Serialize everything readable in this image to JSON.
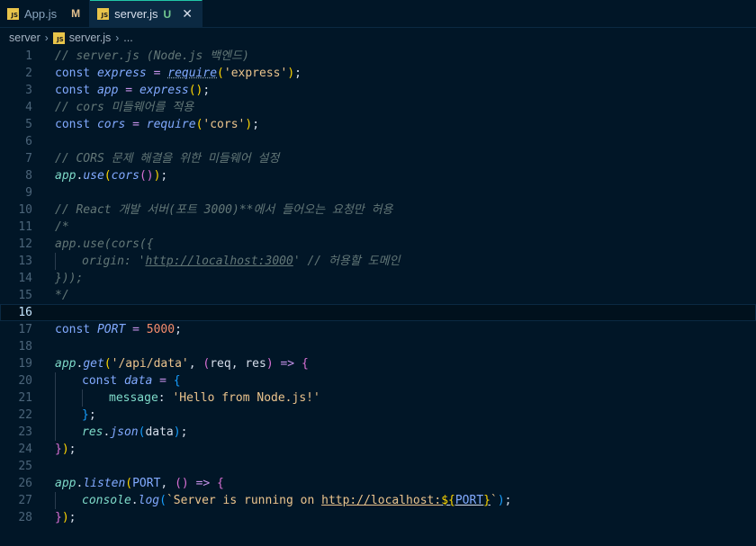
{
  "tabs": [
    {
      "icon": "JS",
      "label": "App.js",
      "status": "M"
    },
    {
      "icon": "JS",
      "label": "server.js",
      "status": "U",
      "close": "✕"
    }
  ],
  "breadcrumb": {
    "folder": "server",
    "file": "server.js",
    "more": "..."
  },
  "lines": [
    {
      "n": "1",
      "html": "<span class='cm'>// server.js (Node.js 백엔드)</span>"
    },
    {
      "n": "2",
      "html": "<span class='kw'>const</span> <span class='var'>express</span> <span class='op'>=</span> <span class='fn dotted'>require</span><span class='p1'>(</span><span class='str'>'express'</span><span class='p1'>)</span><span class='pl'>;</span>"
    },
    {
      "n": "3",
      "html": "<span class='kw'>const</span> <span class='var'>app</span> <span class='op'>=</span> <span class='fn'>express</span><span class='p1'>()</span><span class='pl'>;</span>"
    },
    {
      "n": "4",
      "html": "<span class='cm'>// cors 미들웨어를 적용</span>"
    },
    {
      "n": "5",
      "html": "<span class='kw'>const</span> <span class='var'>cors</span> <span class='op'>=</span> <span class='fn'>require</span><span class='p1'>(</span><span class='str'>'cors'</span><span class='p1'>)</span><span class='pl'>;</span>"
    },
    {
      "n": "6",
      "html": ""
    },
    {
      "n": "7",
      "html": "<span class='cm'>// CORS 문제 해결을 위한 미들웨어 설정</span>"
    },
    {
      "n": "8",
      "html": "<span class='grn' style='font-style:italic'>app</span><span class='pl'>.</span><span class='fn'>use</span><span class='p1'>(</span><span class='fn'>cors</span><span class='p2'>()</span><span class='p1'>)</span><span class='pl'>;</span>"
    },
    {
      "n": "9",
      "html": ""
    },
    {
      "n": "10",
      "html": "<span class='cm'>// React 개발 서버(포트 3000)**에서 들어오는 요청만 허용</span>"
    },
    {
      "n": "11",
      "html": "<span class='cm'>/*</span>"
    },
    {
      "n": "12",
      "html": "<span class='cm'>app.use(cors({</span>"
    },
    {
      "n": "13",
      "html": "<span class='guide'></span><span class='cm'>origin: '<span class='ul'>http://localhost:3000</span>' // 허용할 도메인</span>"
    },
    {
      "n": "14",
      "html": "<span class='cm'>}));</span>"
    },
    {
      "n": "15",
      "html": "<span class='cm'>*/</span>"
    },
    {
      "n": "16",
      "html": "",
      "current": true
    },
    {
      "n": "17",
      "html": "<span class='kw'>const</span> <span class='var'>PORT</span> <span class='op'>=</span> <span class='num'>5000</span><span class='pl'>;</span>"
    },
    {
      "n": "18",
      "html": ""
    },
    {
      "n": "19",
      "html": "<span class='grn' style='font-style:italic'>app</span><span class='pl'>.</span><span class='fn'>get</span><span class='p1'>(</span><span class='str'>'/api/data'</span><span class='pl'>, </span><span class='p2'>(</span><span class='plain'>req</span><span class='pl'>, </span><span class='plain'>res</span><span class='p2'>)</span> <span class='op'>=&gt;</span> <span class='p2'>{</span>"
    },
    {
      "n": "20",
      "html": "<span class='guide'></span><span class='kw'>const</span> <span class='var'>data</span> <span class='op'>=</span> <span class='p3'>{</span>"
    },
    {
      "n": "21",
      "html": "<span class='guide'></span><span class='guide'></span><span class='prop'>message</span><span class='pl'>: </span><span class='str'>'Hello from Node.js!'</span>"
    },
    {
      "n": "22",
      "html": "<span class='guide'></span><span class='p3'>}</span><span class='pl'>;</span>"
    },
    {
      "n": "23",
      "html": "<span class='guide'></span><span class='grn' style='font-style:italic'>res</span><span class='pl'>.</span><span class='fn'>json</span><span class='p3'>(</span><span class='plain'>data</span><span class='p3'>)</span><span class='pl'>;</span>"
    },
    {
      "n": "24",
      "html": "<span class='p2'>}</span><span class='p1'>)</span><span class='pl'>;</span>"
    },
    {
      "n": "25",
      "html": ""
    },
    {
      "n": "26",
      "html": "<span class='grn' style='font-style:italic'>app</span><span class='pl'>.</span><span class='fn'>listen</span><span class='p1'>(</span><span class='fnc'>PORT</span><span class='pl'>, </span><span class='p2'>()</span> <span class='op'>=&gt;</span> <span class='p2'>{</span>"
    },
    {
      "n": "27",
      "html": "<span class='guide'></span><span class='grn' style='font-style:italic'>console</span><span class='pl'>.</span><span class='fn'>log</span><span class='p3'>(</span><span class='tmpl'>`Server is running on <span class='ul'>http://localhost:</span></span><span class='ul'><span class='p1'>${</span><span class='fnc'>PORT</span><span class='p1'>}</span></span><span class='tmpl'>`</span><span class='p3'>)</span><span class='pl'>;</span>"
    },
    {
      "n": "28",
      "html": "<span class='p2'>}</span><span class='p1'>)</span><span class='pl'>;</span>"
    }
  ]
}
